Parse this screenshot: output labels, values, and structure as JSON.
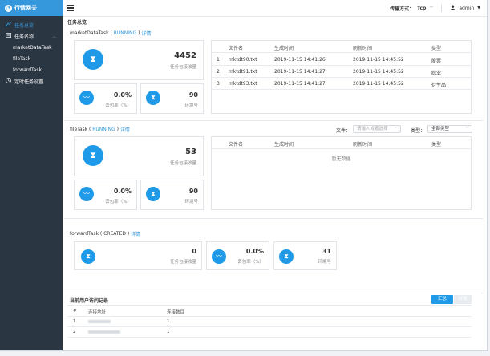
{
  "app": {
    "logo_text": "行情网关"
  },
  "sidebar": {
    "items": [
      {
        "label": "任务总览"
      },
      {
        "label": "任务名称"
      },
      {
        "label": "marketDataTask"
      },
      {
        "label": "fileTask"
      },
      {
        "label": "forwardTask"
      },
      {
        "label": "定时任务设置"
      }
    ]
  },
  "topbar": {
    "transport_label": "传输方式：",
    "transport_value": "Tcp",
    "user": "admin"
  },
  "overview": {
    "title": "任务总览"
  },
  "task1": {
    "name": "marketDataTask",
    "status_open": " ( ",
    "status": "RUNNING",
    "status_close": " ) ",
    "detail": "详情",
    "received": "4452",
    "received_label": "任务包接收量",
    "loss": "0.0%",
    "loss_label": "丢包率（%）",
    "ring": "90",
    "ring_label": "环境号",
    "table": {
      "headers": [
        "文件名",
        "生成时间",
        "刷新时间",
        "类型"
      ],
      "rows": [
        [
          "1",
          "mktdt90.txt",
          "2019-11-15 14:41:26",
          "2019-11-15 14:45:52",
          "股票"
        ],
        [
          "2",
          "mktdt91.txt",
          "2019-11-15 14:41:27",
          "2019-11-15 14:45:52",
          "综业"
        ],
        [
          "3",
          "mktdt93.txt",
          "2019-11-15 14:41:27",
          "2019-11-15 14:45:52",
          "衍生品"
        ]
      ]
    }
  },
  "task2": {
    "name": "fileTask",
    "status_open": " ( ",
    "status": "RUNNING",
    "status_close": " ) ",
    "detail": "详情",
    "file_label": "文件：",
    "file_placeholder": "请输入或者选择",
    "type_label": "类型：",
    "type_value": "全部类型",
    "received": "53",
    "received_label": "任务包接收量",
    "loss": "0.0%",
    "loss_label": "丢包率（%）",
    "ring": "90",
    "ring_label": "环境号",
    "table": {
      "headers": [
        "文件名",
        "生成时间",
        "刷新时间",
        "类型"
      ],
      "empty": "暂无数据"
    }
  },
  "task3": {
    "name": "forwardTask",
    "status_open": " ( ",
    "status": "CREATED",
    "status_close": " ) ",
    "detail": "详情",
    "received": "0",
    "received_label": "任务包接收量",
    "loss": "0.0%",
    "loss_label": "丢包率（%）",
    "ring": "31",
    "ring_label": "环境号"
  },
  "visitors": {
    "title": "当前用户访问记录",
    "btn_summary": "汇总",
    "btn_detail": "详情",
    "headers": [
      "#",
      "连接地址",
      "连接数目"
    ],
    "rows": [
      [
        "1",
        "1"
      ],
      [
        "2",
        "1"
      ]
    ]
  },
  "colors": {
    "accent": "#1e9ae8",
    "sidebar": "#2b3643",
    "logo_bg": "#3598dc"
  }
}
